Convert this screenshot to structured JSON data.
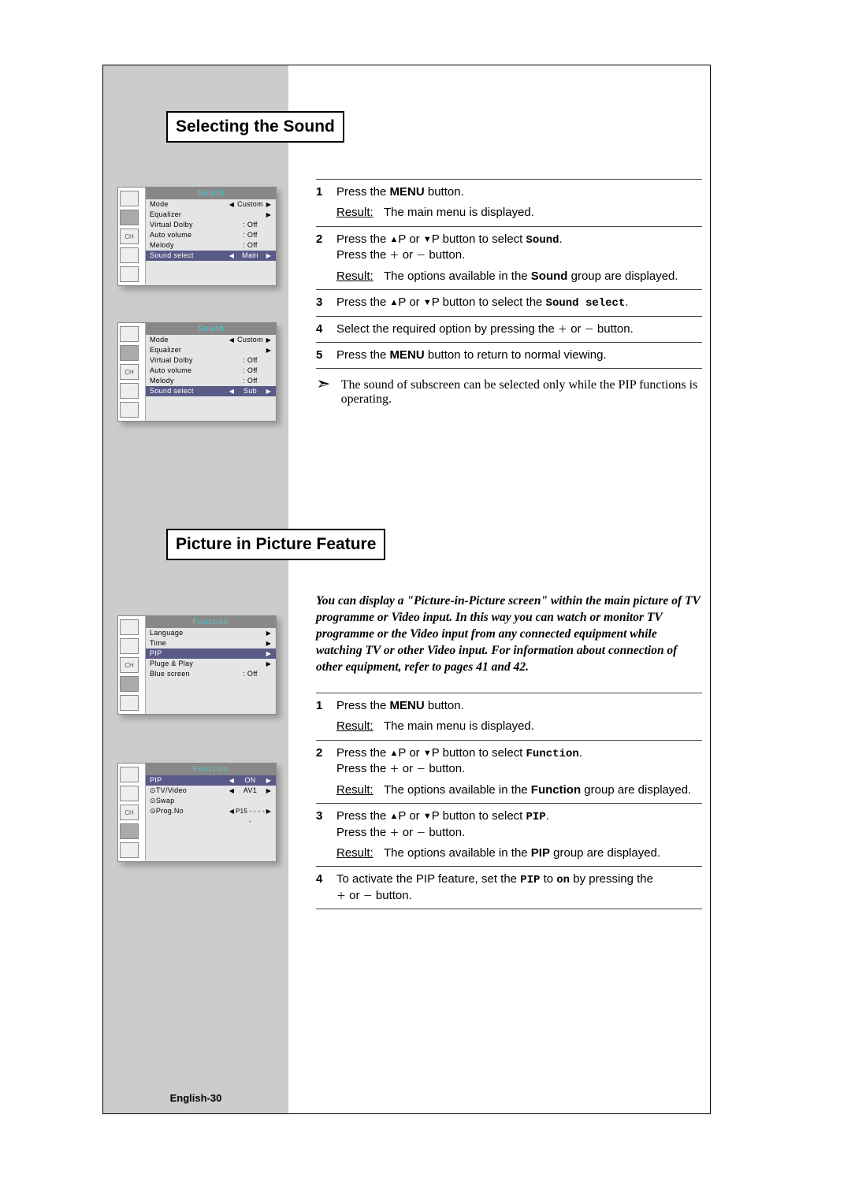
{
  "headings": {
    "selecting_sound": "Selecting the Sound",
    "pip_feature": "Picture in Picture Feature"
  },
  "osd": {
    "sound_title": "Sound",
    "sound_rows": {
      "mode": "Mode",
      "mode_val": "Custom",
      "equalizer": "Equalizer",
      "virtual_dolby": "Virtual Dolby",
      "auto_volume": "Auto volume",
      "melody": "Melody",
      "sound_select": "Sound select",
      "off": ": Off",
      "main": "Main",
      "sub": "Sub"
    },
    "function_title": "Function",
    "function_rows": {
      "language": "Language",
      "time": "Time",
      "pip": "PIP",
      "pluge": "Pluge & Play",
      "blue": "Blue screen",
      "off": ": Off"
    },
    "function2_rows": {
      "pip": "PIP",
      "pip_val": "ON",
      "tvvideo": "TV/Video",
      "tvvideo_val": "AV1",
      "swap": "Swap",
      "progno": "Prog.No",
      "progno_val": "P15 - - - - -"
    },
    "icons": {
      "ch": "CH"
    }
  },
  "steps_sound": {
    "s1a": "Press the ",
    "s1b": "MENU",
    "s1c": " button.",
    "s1_r_label": "Result:",
    "s1_r": "The main menu is displayed.",
    "s2a": "Press the ",
    "s2b": "P or ",
    "s2c": "P button to select ",
    "s2_target": "Sound",
    "s2d": ".",
    "s2e": "Press the  ",
    "s2f": "  or  ",
    "s2g": "  button.",
    "s2_r_label": "Result:",
    "s2_r1": "The options available in the ",
    "s2_r2": "Sound",
    "s2_r3": " group are displayed.",
    "s3a": "Press the ",
    "s3b": "P or ",
    "s3c": "P button to select the ",
    "s3_target": "Sound select",
    "s3d": ".",
    "s4a": "Select the required option by pressing the  ",
    "s4b": "  or  ",
    "s4c": "  button.",
    "s5a": "Press the ",
    "s5b": "MENU",
    "s5c": " button to return to normal viewing.",
    "note": "The sound of subscreen can be selected only while the PIP functions is operating."
  },
  "pip_intro": "You can display a \"Picture-in-Picture screen\" within the main picture of TV programme or Video input. In this way you can watch or monitor TV programme or the Video input from any connected equipment while watching TV or other Video input. For information about connection of other equipment, refer to pages 41 and 42.",
  "steps_pip": {
    "s1a": "Press the ",
    "s1b": "MENU",
    "s1c": " button.",
    "s1_r_label": "Result:",
    "s1_r": "The main menu is displayed.",
    "s2a": "Press the ",
    "s2b": "P or ",
    "s2c": "P button to select ",
    "s2_target": "Function",
    "s2d": ".",
    "s2e": "Press the  ",
    "s2f": "  or  ",
    "s2g": "  button.",
    "s2_r_label": "Result:",
    "s2_r1": "The options available in the ",
    "s2_r2": "Function",
    "s2_r3": " group are displayed.",
    "s3a": "Press the ",
    "s3b": "P or ",
    "s3c": "P button to select ",
    "s3_target": "PIP",
    "s3d": ".",
    "s3e": "Press the  ",
    "s3f": "  or  ",
    "s3g": "  button.",
    "s3_r_label": "Result:",
    "s3_r1": "The options available in the ",
    "s3_r2": "PIP",
    "s3_r3": " group are displayed.",
    "s4a": "To activate the PIP feature, set the ",
    "s4b": "PIP",
    "s4c": " to ",
    "s4d": "on",
    "s4e": " by pressing the ",
    "s4f": " or ",
    "s4g": " button."
  },
  "page_num": "English-30",
  "sym": {
    "triU": "▲",
    "triD": "▼",
    "triL": "◀",
    "triR": "▶",
    "volU": "＋",
    "volD": "－",
    "note_arrow": "➣",
    "enter": "⊙"
  }
}
